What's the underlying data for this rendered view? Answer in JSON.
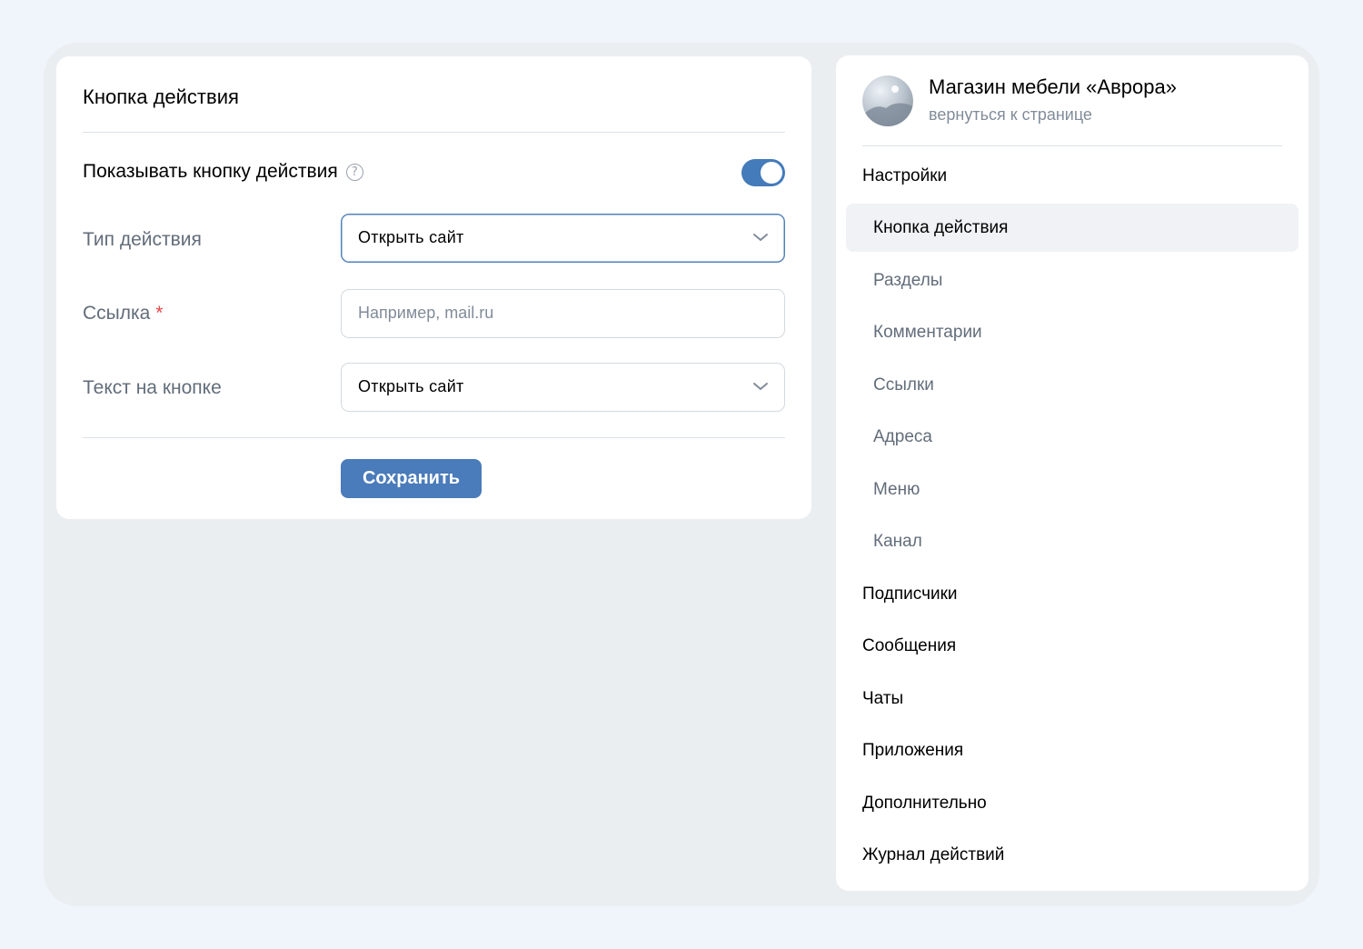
{
  "action_card": {
    "title": "Кнопка действия",
    "show_toggle": {
      "label": "Показывать кнопку действия",
      "help_glyph": "?",
      "enabled": true
    },
    "fields": {
      "action_type": {
        "label": "Тип действия",
        "value": "Открыть сайт"
      },
      "link": {
        "label": "Ссылка",
        "required_mark": "*",
        "placeholder": "Например, mail.ru"
      },
      "button_text": {
        "label": "Текст на кнопке",
        "value": "Открыть сайт"
      }
    },
    "save_label": "Сохранить"
  },
  "nav": {
    "community_name": "Магазин мебели «Аврора»",
    "back_link": "вернуться к странице",
    "items": [
      {
        "label": "Настройки",
        "level": 0
      },
      {
        "label": "Кнопка действия",
        "level": 1,
        "active": true
      },
      {
        "label": "Разделы",
        "level": 1
      },
      {
        "label": "Комментарии",
        "level": 1
      },
      {
        "label": "Ссылки",
        "level": 1
      },
      {
        "label": "Адреса",
        "level": 1
      },
      {
        "label": "Меню",
        "level": 1
      },
      {
        "label": "Канал",
        "level": 1
      },
      {
        "label": "Подписчики",
        "level": 0
      },
      {
        "label": "Сообщения",
        "level": 0
      },
      {
        "label": "Чаты",
        "level": 0
      },
      {
        "label": "Приложения",
        "level": 0
      },
      {
        "label": "Дополнительно",
        "level": 0
      },
      {
        "label": "Журнал действий",
        "level": 0
      }
    ]
  },
  "colors": {
    "accent": "#447bba",
    "page_bg": "#f0f5fb",
    "canvas_bg": "#ebeef1",
    "muted_text": "#626d7a",
    "placeholder": "#818c99",
    "required": "#e64646"
  }
}
